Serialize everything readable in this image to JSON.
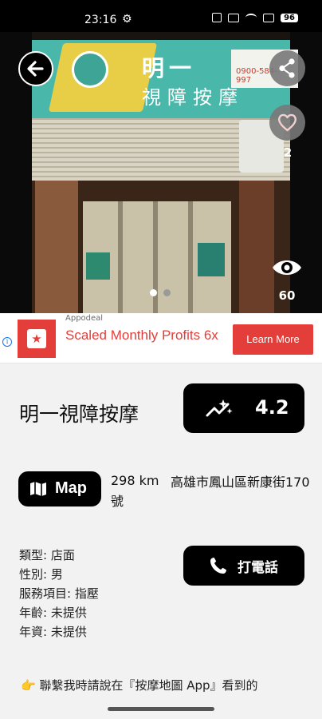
{
  "status_bar": {
    "time": "23:16",
    "battery": "96"
  },
  "photo": {
    "sign_title_line1": "明一",
    "sign_title_line2": "視障按摩",
    "sign_phone": "0900-584-997",
    "indicator_count": 2,
    "active_index": 0
  },
  "actions": {
    "like_count": "2",
    "view_count": "60"
  },
  "ad": {
    "source": "Appodeal",
    "headline": "Scaled Monthly Profits 6x",
    "cta": "Learn More",
    "brand_color": "#e33e3a"
  },
  "shop": {
    "name": "明一視障按摩",
    "rating": "4.2",
    "map_label": "Map",
    "distance": "298 km",
    "address": "高雄市鳳山區新康街170號",
    "info": {
      "type": "類型: 店面",
      "gender": "性別: 男",
      "services": "服務項目: 指壓",
      "age": "年齡: 未提供",
      "experience": "年資: 未提供"
    },
    "call_label": "打電話",
    "footer": "👉 聯繫我時請說在『按摩地圖 App』看到的"
  }
}
